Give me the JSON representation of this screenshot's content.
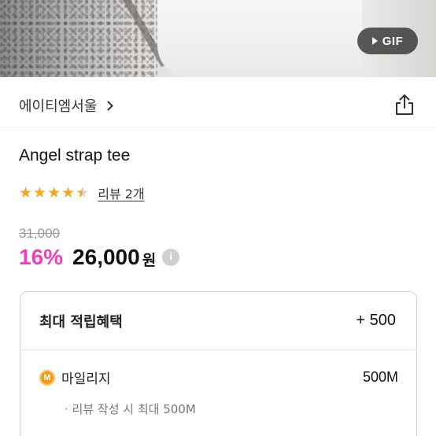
{
  "hero": {
    "badge_label": "GIF",
    "badge_icon": "play-icon"
  },
  "store": {
    "name": "에이티엠서울",
    "chevron_icon": "chevron-right-icon",
    "share_icon": "share-icon"
  },
  "product": {
    "title": "Angel strap tee",
    "rating": 4.5,
    "review_link": "리뷰 2개",
    "original_price": "31,000",
    "discount": "16%",
    "price": "26,000",
    "currency": "원",
    "info_icon_glyph": "i"
  },
  "benefits": {
    "title": "최대 적립혜택",
    "total": "+ 500",
    "mileage": {
      "icon_glyph": "M",
      "label": "마일리지",
      "value": "500M",
      "note": "· 리뷰 작성 시 최대 500M"
    }
  },
  "colors": {
    "discount": "#f03fb9",
    "star": "#f5a623",
    "coin": "#f59b1a"
  }
}
